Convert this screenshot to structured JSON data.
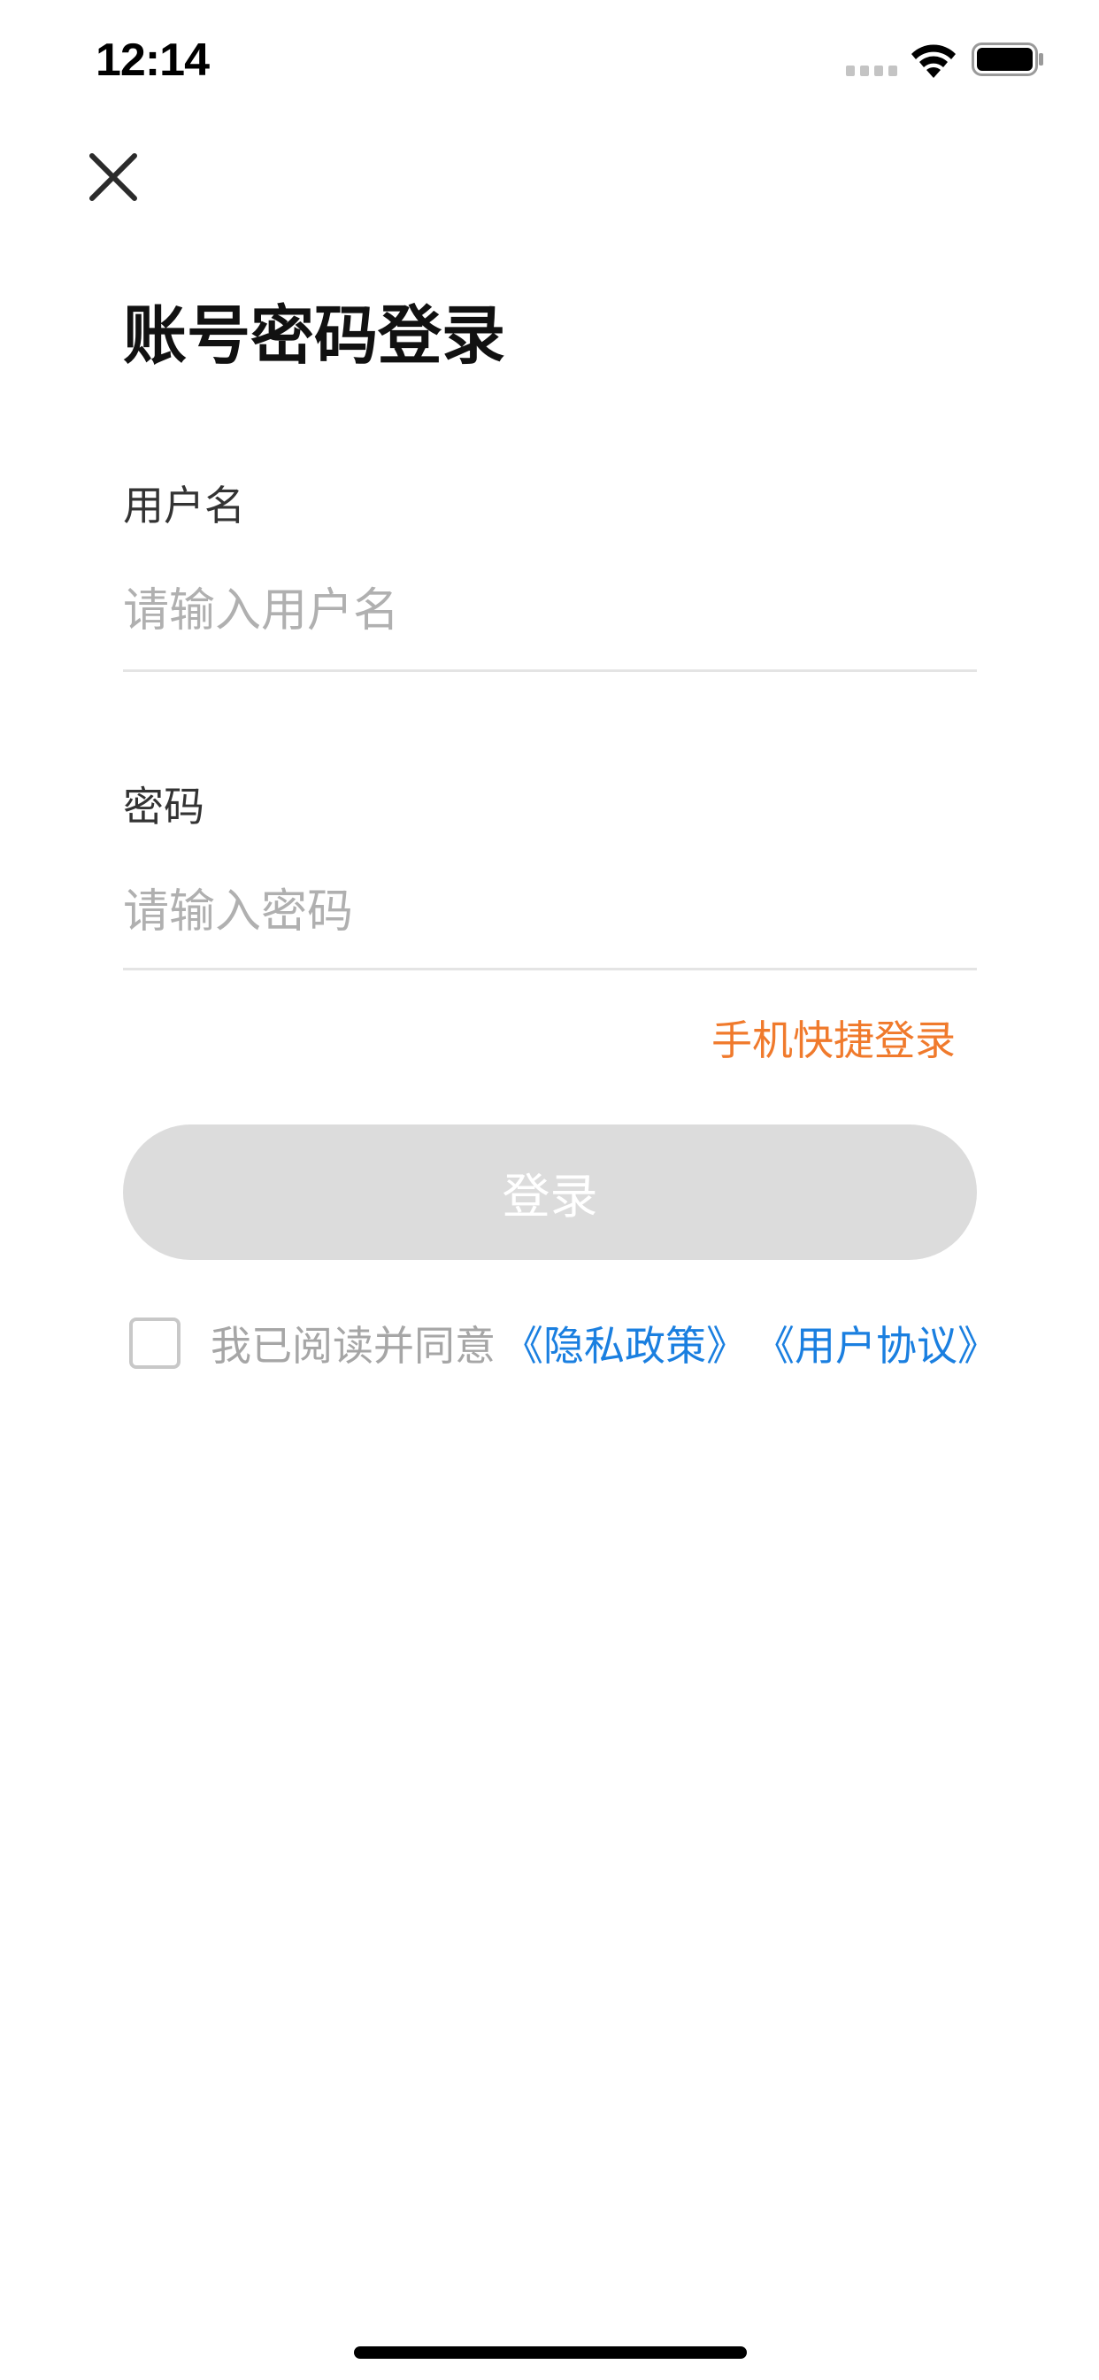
{
  "status_bar": {
    "time": "12:14"
  },
  "close_icon": "close-icon",
  "page": {
    "title": "账号密码登录"
  },
  "username": {
    "label": "用户名",
    "value": "",
    "placeholder": "请输入用户名"
  },
  "password": {
    "label": "密码",
    "value": "",
    "placeholder": "请输入密码"
  },
  "quick_login": {
    "label": "手机快捷登录"
  },
  "login_button": {
    "label": "登录",
    "enabled": false
  },
  "agreement": {
    "checked": false,
    "text": "我已阅读并同意",
    "privacy_link": "《隐私政策》",
    "terms_link": "《用户协议》"
  },
  "colors": {
    "accent_orange": "#f07a2c",
    "link_blue": "#1a7fe0",
    "button_disabled": "#dcdcdc",
    "placeholder_gray": "#b0b0b0"
  }
}
